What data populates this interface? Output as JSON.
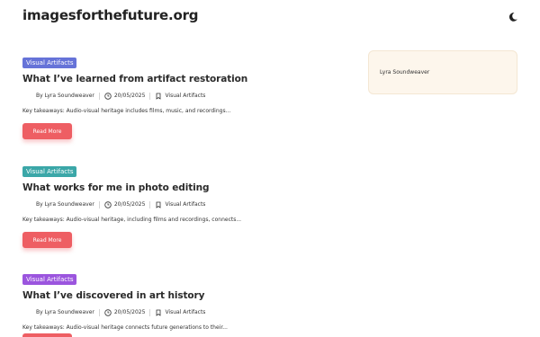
{
  "site": {
    "title": "imagesforthefuture.org"
  },
  "header": {
    "theme_icon": "moon-icon"
  },
  "posts": [
    {
      "category": "Visual Artifacts",
      "category_color": "#6673d8",
      "title": "What I’ve learned from artifact restoration",
      "author": "By Lyra Soundweaver",
      "date": "20/05/2025",
      "tag": "Visual Artifacts",
      "excerpt": "Key takeaways: Audio-visual heritage includes films, music, and recordings...",
      "button": "Read More"
    },
    {
      "category": "Visual Artifacts",
      "category_color": "#3ba7a8",
      "title": "What works for me in photo editing",
      "author": "By Lyra Soundweaver",
      "date": "20/05/2025",
      "tag": "Visual Artifacts",
      "excerpt": "Key takeaways: Audio-visual heritage, including films and recordings, connects...",
      "button": "Read More"
    },
    {
      "category": "Visual Artifacts",
      "category_color": "#9b55de",
      "title": "What I’ve discovered in art history",
      "author": "By Lyra Soundweaver",
      "date": "20/05/2025",
      "tag": "Visual Artifacts",
      "excerpt": "Key takeaways: Audio-visual heritage connects future generations to their...",
      "button": "Read More"
    }
  ],
  "sidebar": {
    "author": "Lyra Soundweaver"
  },
  "colors": {
    "accent": "#ee5e63",
    "sidebar_bg": "#fdf6ec"
  }
}
